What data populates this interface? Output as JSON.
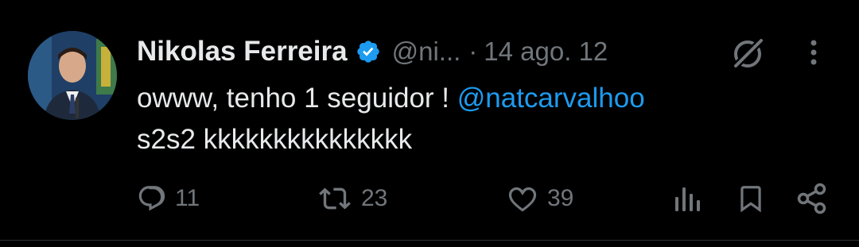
{
  "tweet": {
    "author": {
      "name": "Nikolas Ferreira",
      "handle": "@ni...",
      "verified": true
    },
    "separator": "·",
    "timestamp": "14 ago. 12",
    "text_main": "owww, tenho 1 seguidor ! ",
    "mention": "@natcarvalhoo",
    "text_line2": "s2s2 kkkkkkkkkkkkkkk",
    "actions": {
      "replies": "11",
      "retweets": "23",
      "likes": "39"
    }
  },
  "colors": {
    "background": "#000000",
    "text": "#e7e9ea",
    "muted": "#71767b",
    "accent": "#1d9bf0"
  },
  "icons": [
    "verified-badge-icon",
    "grok-icon",
    "more-options-icon",
    "reply-icon",
    "retweet-icon",
    "like-icon",
    "views-icon",
    "bookmark-icon",
    "share-icon"
  ]
}
